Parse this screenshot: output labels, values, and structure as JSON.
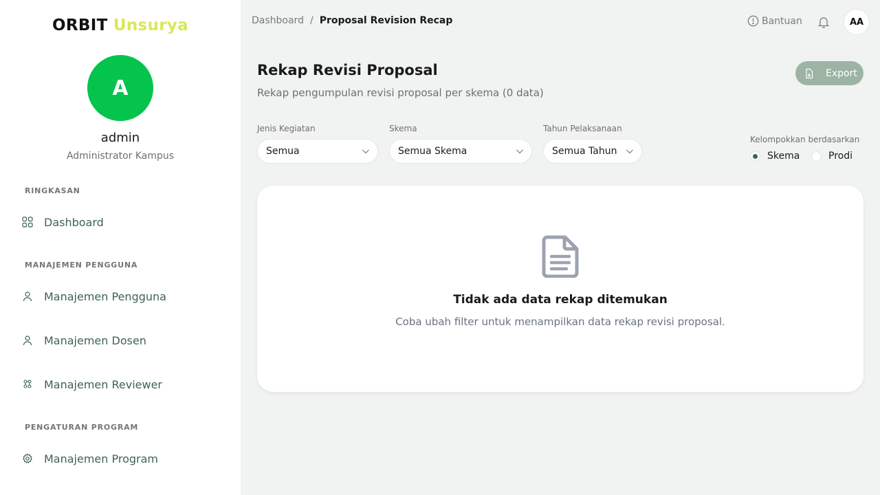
{
  "brand": {
    "part1": "ORBIT",
    "part2": "Unsurya"
  },
  "user": {
    "initial": "A",
    "name": "admin",
    "role": "Administrator Kampus"
  },
  "sidebar": {
    "sections": [
      {
        "label": "RINGKASAN"
      },
      {
        "label": "MANAJEMEN PENGGUNA"
      },
      {
        "label": "PENGATURAN PROGRAM"
      }
    ],
    "items": [
      {
        "label": "Dashboard",
        "icon": "dashboard-grid-icon"
      },
      {
        "label": "Manajemen Pengguna",
        "icon": "user-icon"
      },
      {
        "label": "Manajemen Dosen",
        "icon": "user-icon"
      },
      {
        "label": "Manajemen Reviewer",
        "icon": "reviewer-group-icon"
      },
      {
        "label": "Manajemen Program",
        "icon": "gear-icon"
      }
    ]
  },
  "breadcrumb": {
    "home": "Dashboard",
    "separator": "/",
    "current": "Proposal Revision Recap"
  },
  "topbar": {
    "help_label": "Bantuan",
    "avatar_initials": "AA"
  },
  "page": {
    "title": "Rekap Revisi Proposal",
    "subtitle": "Rekap pengumpulan revisi proposal per skema (0 data)",
    "export_label": "Export"
  },
  "filters": {
    "jenis": {
      "label": "Jenis Kegiatan",
      "value": "Semua"
    },
    "skema": {
      "label": "Skema",
      "value": "Semua Skema"
    },
    "tahun": {
      "label": "Tahun Pelaksanaan",
      "value": "Semua Tahun"
    }
  },
  "grouping": {
    "label": "Kelompokkan berdasarkan",
    "options": [
      {
        "label": "Skema",
        "selected": true
      },
      {
        "label": "Prodi",
        "selected": false
      }
    ]
  },
  "empty_state": {
    "title": "Tidak ada data rekap ditemukan",
    "message": "Coba ubah filter untuk menampilkan data rekap revisi proposal."
  },
  "colors": {
    "accent": "#3e6450",
    "brand_green": "#04c44d",
    "brand_lime": "#d7e85a",
    "export_button": "#9db3a3"
  }
}
